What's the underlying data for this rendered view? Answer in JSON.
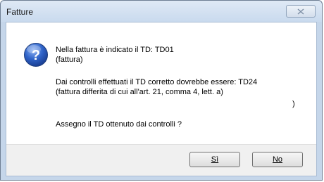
{
  "window": {
    "title": "Fatture",
    "close_icon": "close-icon"
  },
  "message": {
    "icon": "question-icon",
    "line1": "Nella fattura è indicato il TD: TD01",
    "line2": "(fattura)",
    "line3": "Dai controlli effettuati il TD corretto dovrebbe essere: TD24",
    "line4": "(fattura differita di cui all'art. 21, comma 4, lett. a)",
    "stray_paren": ")",
    "question": "Assegno il TD ottenuto dai controlli ?"
  },
  "buttons": {
    "yes_label": "Sì",
    "no_label": "No"
  }
}
